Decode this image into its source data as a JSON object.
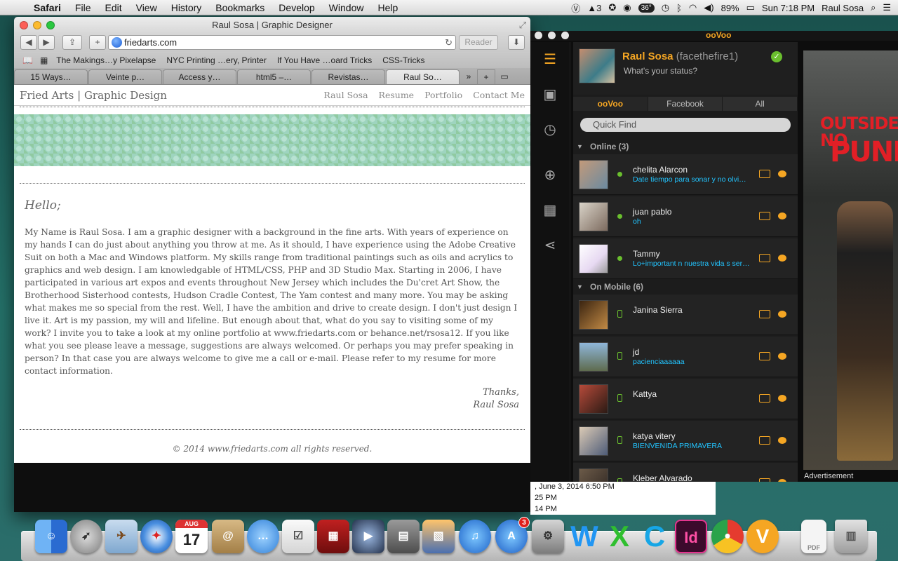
{
  "menubar": {
    "apple": "",
    "app": "Safari",
    "items": [
      "File",
      "Edit",
      "View",
      "History",
      "Bookmarks",
      "Develop",
      "Window",
      "Help"
    ],
    "adobe_count": "3",
    "temperature": "36°",
    "battery": "89%",
    "clock": "Sun 7:18 PM",
    "user": "Raul Sosa"
  },
  "safari": {
    "window_title": "Raul Sosa | Graphic Designer",
    "url": "friedarts.com",
    "reader_label": "Reader",
    "bookmarks": [
      "The Makings…y Pixelapse",
      "NYC Printing …ery, Printer",
      "If You Have …oard Tricks",
      "CSS-Tricks"
    ],
    "tabs": [
      "15 Ways…",
      "Veinte p…",
      "Access y…",
      "html5 –…",
      "Revistas…",
      "Raul So…"
    ]
  },
  "page": {
    "logo": "Fried Arts | Graphic Design",
    "nav": [
      "Raul Sosa",
      "Resume",
      "Portfolio",
      "Contact Me"
    ],
    "greeting": "Hello;",
    "bio": "My Name is Raul Sosa. I am a graphic designer with a background in the fine arts. With years of experience on my hands I can do just about anything you throw at me. As it should, I have experience using the Adobe Creative Suit on both a Mac and Windows platform. My skills range from traditional paintings such as oils and acrylics to graphics and web design. I am knowledgable of HTML/CSS, PHP and 3D Studio Max. Starting in 2006, I have participated in various art expos and events throughout New Jersey which includes the Du'cret Art Show, the Brotherhood Sisterhood contests, Hudson Cradle Contest, The Yam contest and many more. You may be asking what makes me so special from the rest. Well, I have the ambition and drive to create design. I don't just design I live it. Art is my passion, my will and lifeline. But enough about that, what do you say to visiting some of my work? I invite you to take a look at my online portfolio at www.friedarts.com or behance.net/rsosa12. If you like what you see please leave a message, suggestions are always welcomed. Or perhaps you may prefer speaking in person? In that case you are always welcome to give me a call or e-mail. Please refer to my resume for more contact information.",
    "thanks": "Thanks,",
    "signature": "Raul Sosa",
    "copyright": "© 2014 www.friedarts.com all rights reserved."
  },
  "notification": {
    "lines": [
      ", June 3, 2014 6:50 PM",
      "25 PM",
      "14 PM"
    ]
  },
  "oovoo": {
    "logo": "ooVoo",
    "profile_name": "Raul Sosa",
    "profile_handle": "(facethefire1)",
    "status_prompt": "What's your status?",
    "filter_tabs": [
      "ooVoo",
      "Facebook",
      "All"
    ],
    "quick_find": "Quick Find",
    "groups": [
      {
        "label": "Online (3)",
        "contacts": [
          {
            "name": "chelita Alarcon",
            "message": "Date tiempo para sonar y no olvi…"
          },
          {
            "name": "juan pablo",
            "message": "oh"
          },
          {
            "name": "Tammy",
            "message": "Lo+important n nuestra vida s ser…"
          }
        ]
      },
      {
        "label": "On Mobile (6)",
        "contacts": [
          {
            "name": "Janina Sierra",
            "message": ""
          },
          {
            "name": "jd",
            "message": "pacienciaaaaaa"
          },
          {
            "name": "Kattya",
            "message": ""
          },
          {
            "name": "katya vitery",
            "message": "BIENVENIDA PRIMAVERA"
          },
          {
            "name": "Kleber Alvarado",
            "message": ""
          }
        ]
      }
    ],
    "ad_title": "OUTSIDE NO",
    "ad_punk": "PUNK",
    "ad_label": "Advertisement"
  },
  "dock": {
    "calendar_month": "AUG",
    "calendar_day": "17",
    "appstore_badge": "3",
    "word_letter": "W",
    "excel_letter": "X",
    "cloud_letter": "C",
    "indesign_letter": "Id",
    "oovoo_letter": "V",
    "pdf_label": "PDF"
  },
  "colors": {
    "accent": "#f5a623",
    "message_blue": "#22c4ff",
    "online_green": "#6abf2e",
    "banner_mint": "#9ed4bf"
  }
}
